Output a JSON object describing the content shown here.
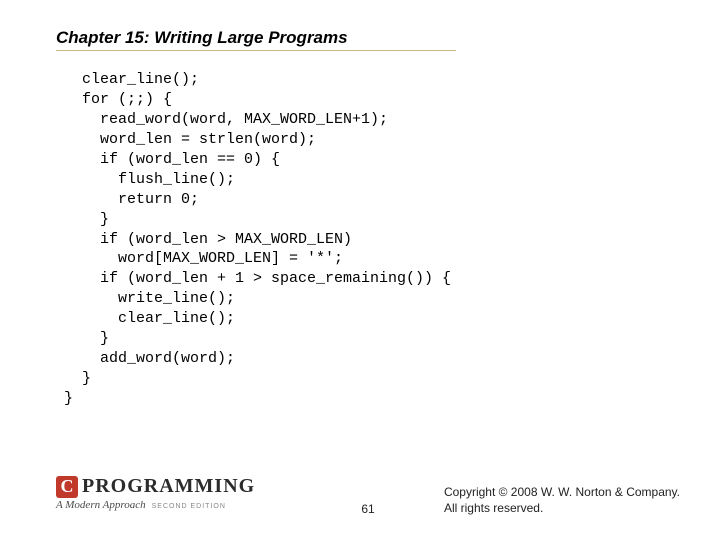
{
  "title": "Chapter 15: Writing Large Programs",
  "code_lines": [
    "  clear_line();",
    "  for (;;) {",
    "    read_word(word, MAX_WORD_LEN+1);",
    "    word_len = strlen(word);",
    "    if (word_len == 0) {",
    "      flush_line();",
    "      return 0;",
    "    }",
    "    if (word_len > MAX_WORD_LEN)",
    "      word[MAX_WORD_LEN] = '*';",
    "    if (word_len + 1 > space_remaining()) {",
    "      write_line();",
    "      clear_line();",
    "    }",
    "    add_word(word);",
    "  }",
    "}"
  ],
  "logo": {
    "c_glyph": "C",
    "word": "PROGRAMMING",
    "subtitle": "A Modern Approach",
    "edition": "SECOND EDITION"
  },
  "page_number": "61",
  "copyright_line1": "Copyright © 2008 W. W. Norton & Company.",
  "copyright_line2": "All rights reserved."
}
